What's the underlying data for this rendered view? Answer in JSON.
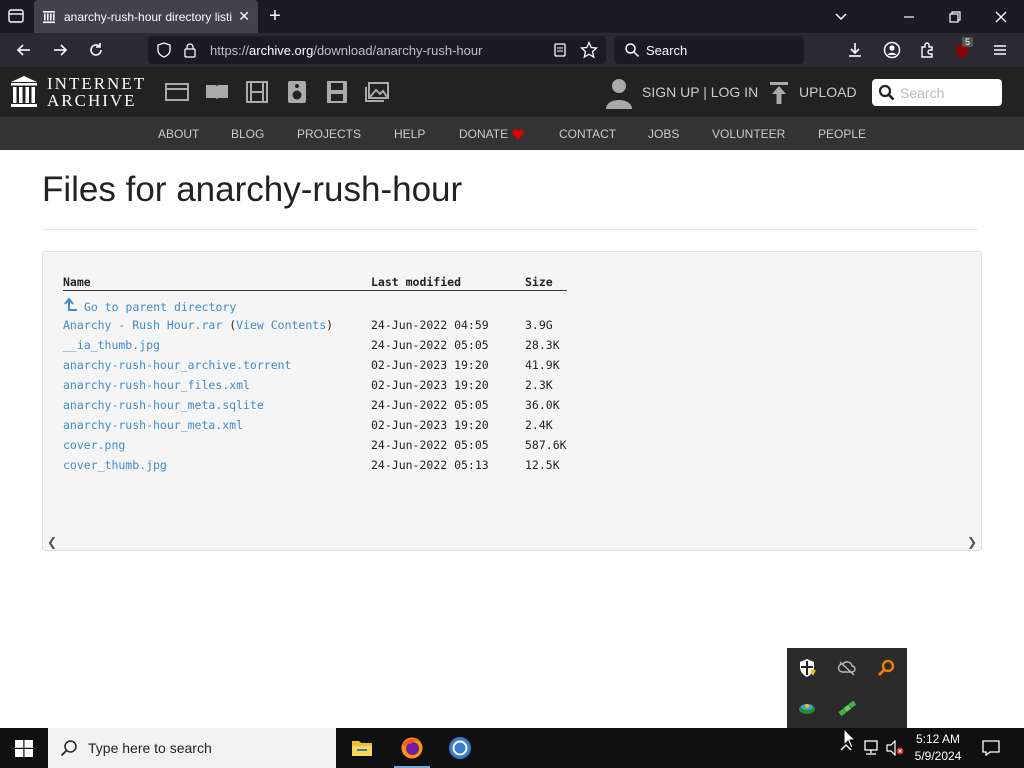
{
  "browser": {
    "tab_title": "anarchy-rush-hour directory listing",
    "url_prefix": "https://",
    "url_host": "archive.org",
    "url_path": "/download/anarchy-rush-hour",
    "search_placeholder": "Search",
    "extension_badge": "5"
  },
  "ia_header": {
    "logo_line1": "INTERNET",
    "logo_line2": "ARCHIVE",
    "signin": "SIGN UP | LOG IN",
    "upload": "UPLOAD",
    "search_placeholder": "Search",
    "nav": [
      "ABOUT",
      "BLOG",
      "PROJECTS",
      "HELP",
      "DONATE",
      "CONTACT",
      "JOBS",
      "VOLUNTEER",
      "PEOPLE"
    ],
    "donate_heart_color": "#e00000"
  },
  "page": {
    "title": "Files for anarchy-rush-hour",
    "columns": {
      "name": "Name",
      "modified": "Last modified",
      "size": "Size"
    },
    "parent_link": "Go to parent directory",
    "files": [
      {
        "name": "Anarchy - Rush Hour.rar",
        "extra_link": "View Contents",
        "modified": "24-Jun-2022 04:59",
        "size": "3.9G"
      },
      {
        "name": "__ia_thumb.jpg",
        "modified": "24-Jun-2022 05:05",
        "size": "28.3K"
      },
      {
        "name": "anarchy-rush-hour_archive.torrent",
        "modified": "02-Jun-2023 19:20",
        "size": "41.9K"
      },
      {
        "name": "anarchy-rush-hour_files.xml",
        "modified": "02-Jun-2023 19:20",
        "size": "2.3K"
      },
      {
        "name": "anarchy-rush-hour_meta.sqlite",
        "modified": "24-Jun-2022 05:05",
        "size": "36.0K"
      },
      {
        "name": "anarchy-rush-hour_meta.xml",
        "modified": "02-Jun-2023 19:20",
        "size": "2.4K"
      },
      {
        "name": "cover.png",
        "modified": "24-Jun-2022 05:05",
        "size": "587.6K"
      },
      {
        "name": "cover_thumb.jpg",
        "modified": "24-Jun-2022 05:13",
        "size": "12.5K"
      }
    ]
  },
  "taskbar": {
    "search_placeholder": "Type here to search",
    "time": "5:12 AM",
    "date": "5/9/2024"
  }
}
